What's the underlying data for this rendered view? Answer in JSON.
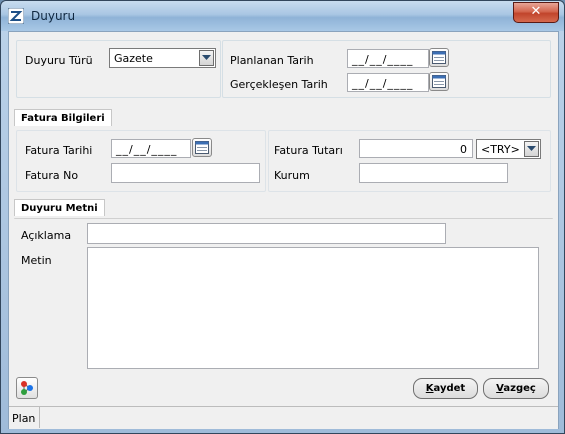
{
  "window": {
    "title": "Duyuru",
    "close_label": "✕"
  },
  "top": {
    "duyuru_turu_label": "Duyuru Türü",
    "duyuru_turu_value": "Gazete",
    "planlanan_tarih_label": "Planlanan Tarih",
    "planlanan_tarih_value": "__/__/____",
    "gerceklesen_tarih_label": "Gerçekleşen Tarih",
    "gerceklesen_tarih_value": "__/__/____"
  },
  "fatura": {
    "tab_label": "Fatura Bilgileri",
    "tarih_label": "Fatura Tarihi",
    "tarih_value": "__/__/____",
    "no_label": "Fatura No",
    "no_value": "",
    "tutar_label": "Fatura Tutarı",
    "tutar_value": "0",
    "currency_value": "<TRY>",
    "kurum_label": "Kurum",
    "kurum_value": ""
  },
  "metin": {
    "tab_label": "Duyuru Metni",
    "aciklama_label": "Açıklama",
    "aciklama_value": "",
    "metin_label": "Metin",
    "metin_value": ""
  },
  "buttons": {
    "kaydet_underline": "K",
    "kaydet_rest": "aydet",
    "vazgec_underline": "V",
    "vazgec_rest": "azgeç"
  },
  "status": {
    "mode": "Plan"
  }
}
